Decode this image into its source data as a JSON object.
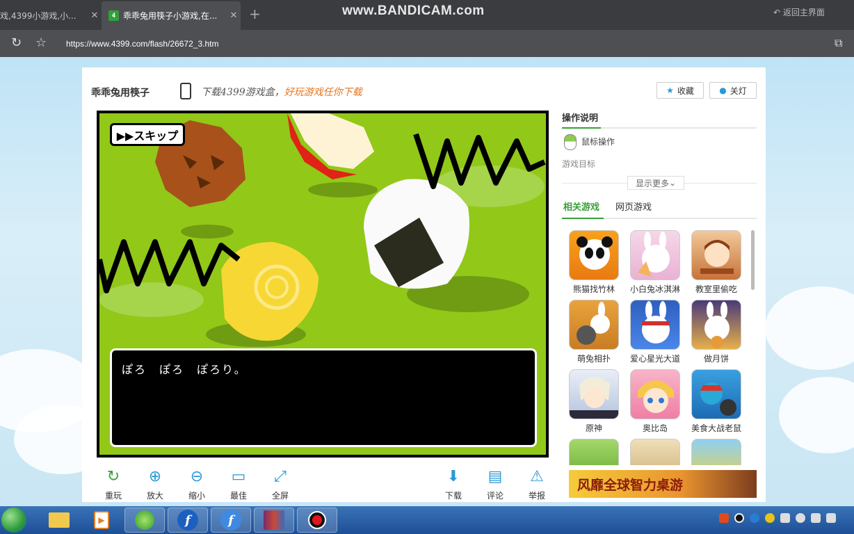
{
  "browser": {
    "tabs": [
      {
        "title": "戏,4399小游戏,小..."
      },
      {
        "title": "乖乖兔用筷子小游戏,在..."
      }
    ],
    "new_tab": "+",
    "watermark": "www.BANDICAM.com",
    "back_home": "返回主界面",
    "url": "https://www.4399.com/flash/26672_3.htm"
  },
  "page": {
    "game_title": "乖乖兔用筷子",
    "promo_prefix": "下载4399游戏盒，",
    "promo_highlight": "好玩游戏任你下载",
    "favorite_label": "收藏",
    "lights_label": "关灯"
  },
  "game": {
    "skip_label": "▶▶スキップ",
    "dialog_text": "ぽろ　ぽろ　ぽろり。"
  },
  "toolbar": {
    "left": [
      {
        "label": "重玩",
        "icon": "replay-icon"
      },
      {
        "label": "放大",
        "icon": "zoom-in-icon"
      },
      {
        "label": "缩小",
        "icon": "zoom-out-icon"
      },
      {
        "label": "最佳",
        "icon": "best-size-icon"
      },
      {
        "label": "全屏",
        "icon": "fullscreen-icon"
      }
    ],
    "right": [
      {
        "label": "下载",
        "icon": "download-icon"
      },
      {
        "label": "评论",
        "icon": "comment-icon"
      },
      {
        "label": "举报",
        "icon": "report-icon"
      }
    ]
  },
  "sidebar": {
    "instructions_title": "操作说明",
    "mouse_label": "鼠标操作",
    "goal_label": "游戏目标",
    "show_more": "显示更多",
    "tab_related": "相关游戏",
    "tab_web": "网页游戏",
    "games": [
      {
        "name": "熊猫找竹林"
      },
      {
        "name": "小白兔冰淇淋"
      },
      {
        "name": "教室里偷吃"
      },
      {
        "name": "萌兔相扑"
      },
      {
        "name": "爱心星光大道"
      },
      {
        "name": "做月饼"
      },
      {
        "name": "原神"
      },
      {
        "name": "奥比岛"
      },
      {
        "name": "美食大战老鼠"
      }
    ],
    "banner_text": "风靡全球智力桌游"
  },
  "colors": {
    "accent_green": "#3aa137",
    "toolbar_blue": "#2a98d6",
    "game_bg": "#92c818",
    "promo_orange": "#e8731a"
  }
}
